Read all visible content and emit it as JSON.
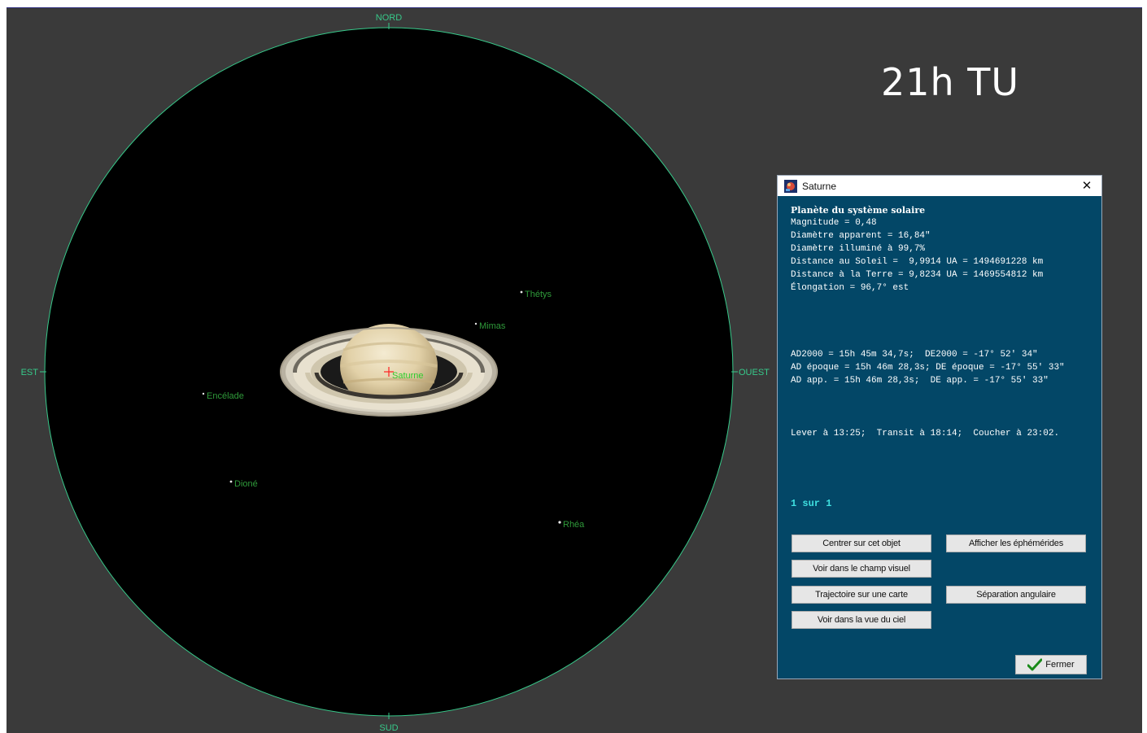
{
  "time_caption": "21h TU",
  "sky": {
    "compass": {
      "north": "NORD",
      "south": "SUD",
      "east": "EST",
      "west": "OUEST"
    },
    "planet_label": "Saturne",
    "moons": [
      {
        "name": "Thétys"
      },
      {
        "name": "Mimas"
      },
      {
        "name": "Encélade"
      },
      {
        "name": "Dioné"
      },
      {
        "name": "Rhéa"
      }
    ],
    "colors": {
      "background": "#3a3a3a",
      "field": "#000000",
      "field_border": "#37c98a",
      "label": "#37c98a",
      "moon_label": "#2f9a3a",
      "marker": "#ff2020"
    }
  },
  "dialog": {
    "title": "Saturne",
    "close_symbol": "✕",
    "heading": "Planète du système solaire",
    "lines": [
      "Magnitude = 0,48",
      "Diamètre apparent = 16,84\"",
      "Diamètre illuminé à 99,7%",
      "Distance au Soleil =  9,9914 UA = 1494691228 km",
      "Distance à la Terre = 9,8234 UA = 1469554812 km",
      "Élongation = 96,7° est"
    ],
    "coords": [
      "AD2000 = 15h 45m 34,7s;  DE2000 = -17° 52' 34\"",
      "AD époque = 15h 46m 28,3s; DE époque = -17° 55' 33\"",
      "AD app. = 15h 46m 28,3s;  DE app. = -17° 55' 33\""
    ],
    "rise_transit_set": "Lever à 13:25;  Transit à 18:14;  Coucher à 23:02.",
    "page_counter": "1 sur 1",
    "buttons": {
      "center": "Centrer sur cet objet",
      "ephemeris": "Afficher les éphémérides",
      "field_view": "Voir dans le champ visuel",
      "trajectory": "Trajectoire sur une carte",
      "separation": "Séparation angulaire",
      "sky_view": "Voir dans la vue du ciel",
      "close": "Fermer"
    },
    "colors": {
      "background": "#034767",
      "text": "#ffffff",
      "counter": "#3fe0e0"
    }
  }
}
